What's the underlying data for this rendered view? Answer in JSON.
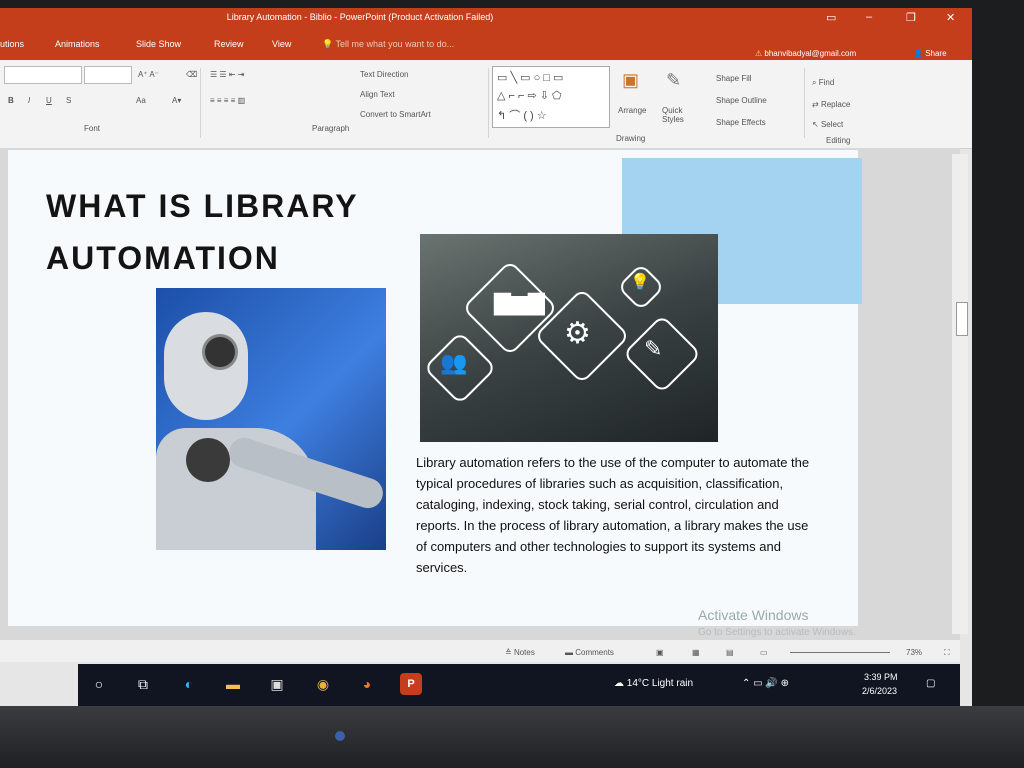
{
  "window": {
    "title": "Library Automation - Biblio - PowerPoint (Product Activation Failed)",
    "controls": {
      "minimize": "–",
      "restore": "❐",
      "close": "✕"
    }
  },
  "tabs": [
    "utions",
    "Animations",
    "Slide Show",
    "Review",
    "View"
  ],
  "tell_me": "Tell me what you want to do...",
  "account": {
    "email": "bhanvibadyal@gmail.com",
    "share_label": "Share"
  },
  "ribbon": {
    "groups": {
      "font": "Font",
      "paragraph": "Paragraph",
      "drawing": "Drawing",
      "editing": "Editing"
    },
    "paragraph_items": {
      "text_direction": "Text Direction",
      "align_text": "Align Text",
      "convert_smartart": "Convert to SmartArt"
    },
    "drawing_items": {
      "arrange": "Arrange",
      "quick_styles": "Quick Styles",
      "shape_fill": "Shape Fill",
      "shape_outline": "Shape Outline",
      "shape_effects": "Shape Effects"
    },
    "editing_items": {
      "find": "Find",
      "replace": "Replace",
      "select": "Select"
    },
    "font_letters": {
      "bold": "B",
      "italic": "I",
      "underline": "U",
      "strike": "S",
      "case": "Aa"
    }
  },
  "slide": {
    "heading_line1": "WHAT IS LIBRARY",
    "heading_line2": "AUTOMATION",
    "body": "Library automation refers to the use of the computer to automate the typical procedures of libraries such as acquisition, classification, cataloging, indexing, stock taking, serial control, circulation and reports. In the process of library automation, a library makes the use of computers and other technologies to support its systems and services.",
    "accent_color": "#a3d3f0"
  },
  "watermark": {
    "line1": "Activate Windows",
    "line2": "Go to Settings to activate Windows."
  },
  "status": {
    "notes": "Notes",
    "comments": "Comments",
    "zoom": "73%"
  },
  "taskbar": {
    "icons": [
      "search-icon",
      "task-view-icon",
      "edge-icon",
      "file-explorer-icon",
      "store-icon",
      "chrome-icon",
      "firefox-icon",
      "powerpoint-icon"
    ],
    "weather": "14°C  Light rain",
    "time": "3:39 PM",
    "date": "2/6/2023"
  }
}
